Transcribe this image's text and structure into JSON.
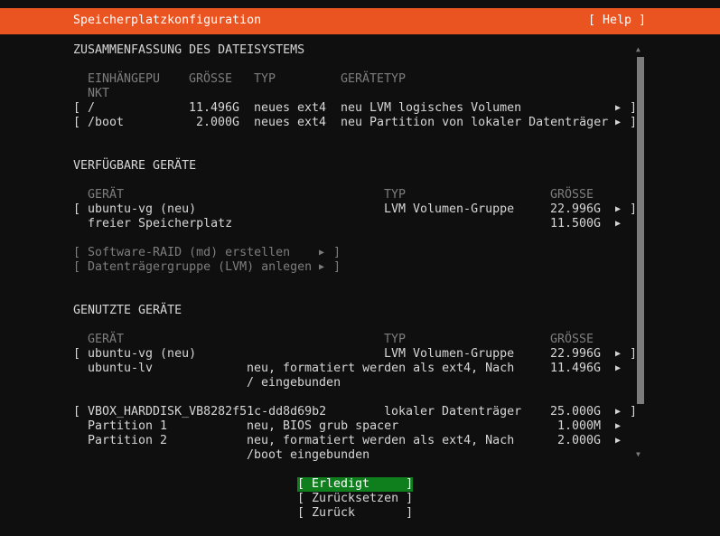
{
  "header": {
    "title": "Speicherplatzkonfiguration",
    "help": "[ Help ]"
  },
  "summary": {
    "heading": "ZUSAMMENFASSUNG DES DATEISYSTEMS",
    "columns": [
      "EINHÄNGEPU",
      "NKT",
      "GRÖSSE",
      "TYP",
      "GERÄTETYP"
    ],
    "rows": [
      {
        "open": "[",
        "mount": "/",
        "size": "11.496G",
        "type": "neues ext4",
        "devtype": "neu LVM logisches Volumen",
        "arrow": "▶",
        "close": "]"
      },
      {
        "open": "[",
        "mount": "/boot",
        "size": "2.000G",
        "type": "neues ext4",
        "devtype": "neu Partition von lokaler Datenträger",
        "arrow": "▶",
        "close": "]"
      }
    ]
  },
  "available": {
    "heading": "VERFÜGBARE GERÄTE",
    "columns": [
      "GERÄT",
      "TYP",
      "GRÖSSE"
    ],
    "rows": [
      {
        "open": "[",
        "device": "ubuntu-vg (neu)",
        "type": "LVM Volumen-Gruppe",
        "size": "22.996G",
        "arrow": "▶",
        "close": "]"
      },
      {
        "device": "freier Speicherplatz",
        "size": "11.500G",
        "arrow": "▶"
      }
    ],
    "actions": [
      {
        "open": "[",
        "label": "Software-RAID (md) erstellen",
        "arrow": "▶",
        "close": "]"
      },
      {
        "open": "[",
        "label": "Datenträgergruppe (LVM) anlegen",
        "arrow": "▶",
        "close": "]"
      }
    ]
  },
  "used": {
    "heading": "GENUTZTE GERÄTE",
    "columns": [
      "GERÄT",
      "TYP",
      "GRÖSSE"
    ],
    "rows": [
      {
        "open": "[",
        "device": "ubuntu-vg (neu)",
        "type": "LVM Volumen-Gruppe",
        "size": "22.996G",
        "arrow": "▶",
        "close": "]"
      },
      {
        "device": "ubuntu-lv",
        "type": "neu, formatiert werden als ext4, Nach",
        "type2": "/ eingebunden",
        "size": "11.496G",
        "arrow": "▶"
      },
      {
        "open": "[",
        "device": "VBOX_HARDDISK_VB8282f51c-dd8d69b2",
        "type": "lokaler Datenträger",
        "size": "25.000G",
        "arrow": "▶",
        "close": "]"
      },
      {
        "device": "Partition 1",
        "type": "neu, BIOS grub spacer",
        "size": "1.000M",
        "arrow": "▶"
      },
      {
        "device": "Partition 2",
        "type": "neu, formatiert werden als ext4, Nach",
        "type2": "/boot eingebunden",
        "size": "2.000G",
        "arrow": "▶"
      }
    ]
  },
  "scroll": {
    "up": "▲",
    "down": "▼"
  },
  "buttons": [
    {
      "label": "[ Erledigt     ]",
      "focused": true
    },
    {
      "label": "[ Zurücksetzen ]",
      "focused": false
    },
    {
      "label": "[ Zurück       ]",
      "focused": false
    }
  ]
}
